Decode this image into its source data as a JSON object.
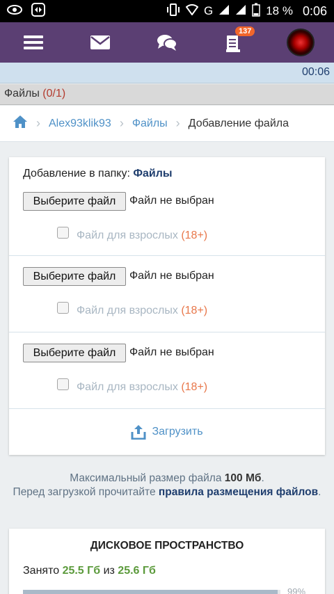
{
  "status_bar": {
    "network": "G",
    "battery": "18 %",
    "time": "0:06"
  },
  "nav": {
    "notifications_count": "137"
  },
  "clock": "00:06",
  "files_header": {
    "label": "Файлы",
    "count": "(0/1)"
  },
  "breadcrumb": {
    "user": "Alex93klik93",
    "files": "Файлы",
    "current": "Добавление файла"
  },
  "form": {
    "folder_prefix": "Добавление в папку:",
    "folder_name": "Файлы",
    "rows": [
      {
        "button": "Выберите файл",
        "status": "Файл не выбран",
        "adult_label": "Файл для взрослых",
        "adult_tag": "(18+)"
      },
      {
        "button": "Выберите файл",
        "status": "Файл не выбран",
        "adult_label": "Файл для взрослых",
        "adult_tag": "(18+)"
      },
      {
        "button": "Выберите файл",
        "status": "Файл не выбран",
        "adult_label": "Файл для взрослых",
        "adult_tag": "(18+)"
      }
    ],
    "upload_label": "Загрузить"
  },
  "info": {
    "line1_prefix": "Максимальный размер файла",
    "max_size": "100 Мб",
    "line1_suffix": ".",
    "line2_prefix": "Перед загрузкой прочитайте",
    "rules_link": "правила размещения файлов",
    "line2_suffix": "."
  },
  "disk": {
    "title": "ДИСКОВОЕ ПРОСТРАНСТВО",
    "used_prefix": "Занято",
    "used": "25.5 Гб",
    "of": "из",
    "total": "25.6 Гб",
    "percent": "99%",
    "fill_fraction": 0.99
  },
  "colors": {
    "header": "#5b3f73",
    "link": "#4f91c7",
    "accent_orange": "#e8774a",
    "used_green": "#5b9a3b"
  }
}
